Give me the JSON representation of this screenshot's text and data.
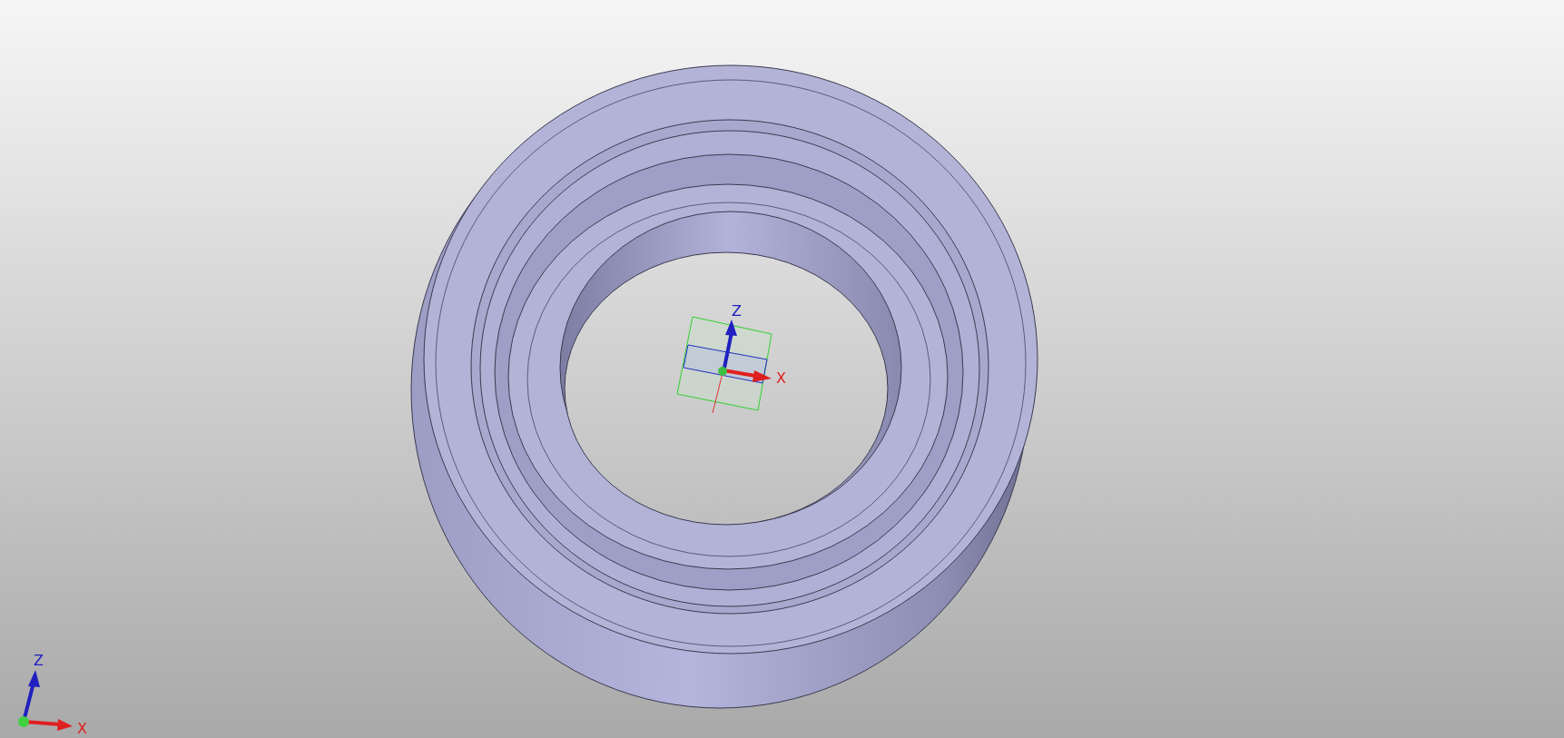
{
  "viewport": {
    "model_triad": {
      "z_label": "Z",
      "x_label": "X"
    },
    "view_axes": {
      "z_label": "Z",
      "x_label": "X"
    }
  }
}
